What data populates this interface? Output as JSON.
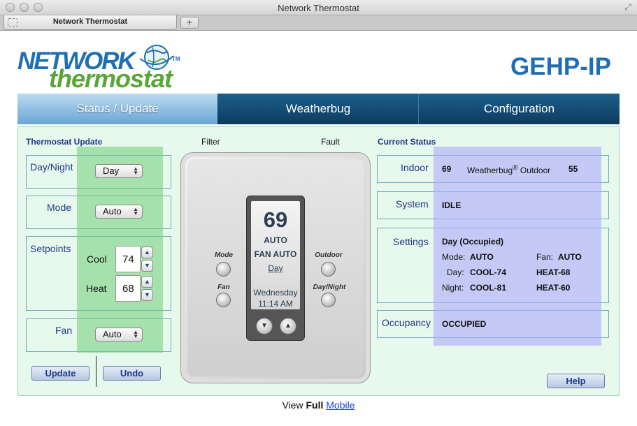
{
  "window": {
    "title": "Network Thermostat",
    "tab_label": "Network Thermostat",
    "new_tab": "+"
  },
  "header": {
    "logo_top": "NETWORK",
    "logo_bottom": "thermostat",
    "logo_tm": "TM",
    "model": "GEHP-IP"
  },
  "nav": {
    "tabs": [
      {
        "label": "Status / Update",
        "active": true
      },
      {
        "label": "Weatherbug"
      },
      {
        "label": "Configuration"
      }
    ]
  },
  "update": {
    "title": "Thermostat Update",
    "day_night": {
      "label": "Day/Night",
      "value": "Day"
    },
    "mode": {
      "label": "Mode",
      "value": "Auto"
    },
    "setpoints": {
      "label": "Setpoints",
      "cool_label": "Cool",
      "cool_value": "74",
      "heat_label": "Heat",
      "heat_value": "68"
    },
    "fan": {
      "label": "Fan",
      "value": "Auto"
    },
    "update_button": "Update",
    "undo_button": "Undo"
  },
  "device": {
    "filter_label": "Filter",
    "fault_label": "Fault",
    "temp": "69",
    "mode_line": "AUTO",
    "fan_line": "FAN AUTO",
    "day_link": "Day",
    "weekday": "Wednesday",
    "time": "11:14 AM",
    "mode_btn": "Mode",
    "fan_btn": "Fan",
    "outdoor_btn": "Outdoor",
    "daynight_btn": "Day/Night"
  },
  "status": {
    "title": "Current Status",
    "indoor_label": "Indoor",
    "indoor_value": "69",
    "weatherbug_label": "Weatherbug",
    "registered": "®",
    "outdoor_label": "Outdoor",
    "outdoor_value": "55",
    "system_label": "System",
    "system_value": "IDLE",
    "settings_label": "Settings",
    "settings_head": "Day (Occupied)",
    "mode_key": "Mode:",
    "mode_val": "AUTO",
    "fan_key": "Fan:",
    "fan_val": "AUTO",
    "day_key": "Day:",
    "day_cool": "COOL-74",
    "day_heat": "HEAT-68",
    "night_key": "Night:",
    "night_cool": "COOL-81",
    "night_heat": "HEAT-60",
    "occupancy_label": "Occupancy",
    "occupancy_value": "OCCUPIED",
    "help_button": "Help"
  },
  "footer": {
    "view": "View",
    "full": "Full",
    "mobile": "Mobile"
  },
  "icons": {
    "globe": "globe-logo-icon",
    "dropdown": "select-arrows-icon",
    "spin_up": "chevron-up-icon",
    "spin_down": "chevron-down-icon"
  }
}
